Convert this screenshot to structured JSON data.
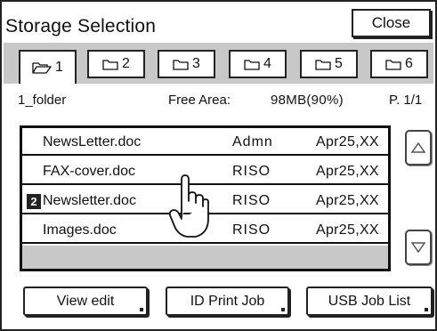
{
  "header": {
    "title": "Storage Selection",
    "close_label": "Close"
  },
  "tabs": [
    {
      "label": "1",
      "icon": "open-folder-icon",
      "active": true
    },
    {
      "label": "2",
      "icon": "folder-icon",
      "active": false
    },
    {
      "label": "3",
      "icon": "folder-icon",
      "active": false
    },
    {
      "label": "4",
      "icon": "folder-icon",
      "active": false
    },
    {
      "label": "5",
      "icon": "folder-icon",
      "active": false
    },
    {
      "label": "6",
      "icon": "folder-icon",
      "active": false
    }
  ],
  "info": {
    "folder_name": "1_folder",
    "free_area_label": "Free Area:",
    "free_area_value": "98MB(90%)",
    "page": "P. 1/1"
  },
  "files": [
    {
      "name": "NewsLetter.doc",
      "owner": "Admn",
      "date": "Apr25,XX",
      "badge": ""
    },
    {
      "name": "FAX-cover.doc",
      "owner": "RISO",
      "date": "Apr25,XX",
      "badge": ""
    },
    {
      "name": "Newsletter.doc",
      "owner": "RISO",
      "date": "Apr25,XX",
      "badge": "2"
    },
    {
      "name": "Images.doc",
      "owner": "RISO",
      "date": "Apr25,XX",
      "badge": ""
    }
  ],
  "buttons": {
    "view_edit": "View edit",
    "id_print_job": "ID Print Job",
    "usb_job_list": "USB Job List"
  },
  "colors": {
    "panel_gray": "#c8c8c8",
    "border": "#222222"
  }
}
